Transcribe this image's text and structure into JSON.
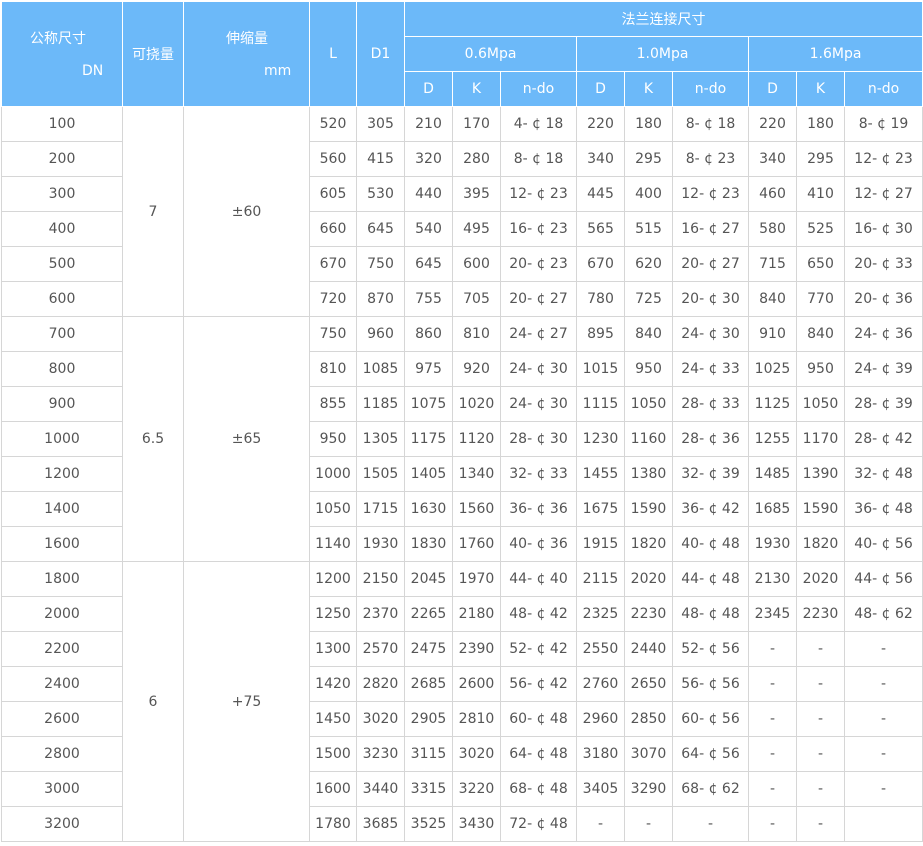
{
  "header": {
    "dn_label": "公称尺寸",
    "dn_unit": "DN",
    "deflection_label": "可挠量",
    "expansion_label": "伸缩量",
    "expansion_unit": "mm",
    "l_label": "L",
    "d1_label": "D1",
    "flange_label": "法兰连接尺寸",
    "pressures": [
      "0.6Mpa",
      "1.0Mpa",
      "1.6Mpa"
    ],
    "sub_cols": [
      "D",
      "K",
      "n-do"
    ]
  },
  "groups": [
    {
      "deflection": "7",
      "expansion": "±60",
      "rows": [
        [
          "100",
          "520",
          "305",
          "210",
          "170",
          "4- ¢ 18",
          "220",
          "180",
          "8- ¢ 18",
          "220",
          "180",
          "8- ¢ 19"
        ],
        [
          "200",
          "560",
          "415",
          "320",
          "280",
          "8- ¢ 18",
          "340",
          "295",
          "8- ¢ 23",
          "340",
          "295",
          "12- ¢ 23"
        ],
        [
          "300",
          "605",
          "530",
          "440",
          "395",
          "12- ¢ 23",
          "445",
          "400",
          "12- ¢ 23",
          "460",
          "410",
          "12- ¢ 27"
        ],
        [
          "400",
          "660",
          "645",
          "540",
          "495",
          "16- ¢ 23",
          "565",
          "515",
          "16- ¢ 27",
          "580",
          "525",
          "16- ¢ 30"
        ],
        [
          "500",
          "670",
          "750",
          "645",
          "600",
          "20- ¢ 23",
          "670",
          "620",
          "20- ¢ 27",
          "715",
          "650",
          "20- ¢ 33"
        ],
        [
          "600",
          "720",
          "870",
          "755",
          "705",
          "20- ¢ 27",
          "780",
          "725",
          "20- ¢ 30",
          "840",
          "770",
          "20- ¢ 36"
        ]
      ]
    },
    {
      "deflection": "6.5",
      "expansion": "±65",
      "rows": [
        [
          "700",
          "750",
          "960",
          "860",
          "810",
          "24- ¢ 27",
          "895",
          "840",
          "24- ¢ 30",
          "910",
          "840",
          "24- ¢ 36"
        ],
        [
          "800",
          "810",
          "1085",
          "975",
          "920",
          "24- ¢ 30",
          "1015",
          "950",
          "24- ¢ 33",
          "1025",
          "950",
          "24- ¢ 39"
        ],
        [
          "900",
          "855",
          "1185",
          "1075",
          "1020",
          "24- ¢ 30",
          "1115",
          "1050",
          "28- ¢ 33",
          "1125",
          "1050",
          "28- ¢ 39"
        ],
        [
          "1000",
          "950",
          "1305",
          "1175",
          "1120",
          "28- ¢ 30",
          "1230",
          "1160",
          "28- ¢ 36",
          "1255",
          "1170",
          "28- ¢ 42"
        ],
        [
          "1200",
          "1000",
          "1505",
          "1405",
          "1340",
          "32- ¢ 33",
          "1455",
          "1380",
          "32- ¢ 39",
          "1485",
          "1390",
          "32- ¢ 48"
        ],
        [
          "1400",
          "1050",
          "1715",
          "1630",
          "1560",
          "36- ¢ 36",
          "1675",
          "1590",
          "36- ¢ 42",
          "1685",
          "1590",
          "36- ¢ 48"
        ],
        [
          "1600",
          "1140",
          "1930",
          "1830",
          "1760",
          "40- ¢ 36",
          "1915",
          "1820",
          "40- ¢ 48",
          "1930",
          "1820",
          "40- ¢ 56"
        ]
      ]
    },
    {
      "deflection": "6",
      "expansion": "+75",
      "rows": [
        [
          "1800",
          "1200",
          "2150",
          "2045",
          "1970",
          "44- ¢ 40",
          "2115",
          "2020",
          "44- ¢ 48",
          "2130",
          "2020",
          "44- ¢ 56"
        ],
        [
          "2000",
          "1250",
          "2370",
          "2265",
          "2180",
          "48- ¢ 42",
          "2325",
          "2230",
          "48- ¢ 48",
          "2345",
          "2230",
          "48- ¢ 62"
        ],
        [
          "2200",
          "1300",
          "2570",
          "2475",
          "2390",
          "52- ¢ 42",
          "2550",
          "2440",
          "52- ¢ 56",
          "-",
          "-",
          "-"
        ],
        [
          "2400",
          "1420",
          "2820",
          "2685",
          "2600",
          "56- ¢ 42",
          "2760",
          "2650",
          "56- ¢ 56",
          "-",
          "-",
          "-"
        ],
        [
          "2600",
          "1450",
          "3020",
          "2905",
          "2810",
          "60- ¢ 48",
          "2960",
          "2850",
          "60- ¢ 56",
          "-",
          "-",
          "-"
        ],
        [
          "2800",
          "1500",
          "3230",
          "3115",
          "3020",
          "64- ¢ 48",
          "3180",
          "3070",
          "64- ¢ 56",
          "-",
          "-",
          "-"
        ],
        [
          "3000",
          "1600",
          "3440",
          "3315",
          "3220",
          "68- ¢ 48",
          "3405",
          "3290",
          "68- ¢ 62",
          "-",
          "-",
          "-"
        ],
        [
          "3200",
          "1780",
          "3685",
          "3525",
          "3430",
          "72- ¢ 48",
          "-",
          "-",
          "-",
          "-",
          "-",
          ""
        ]
      ]
    }
  ]
}
